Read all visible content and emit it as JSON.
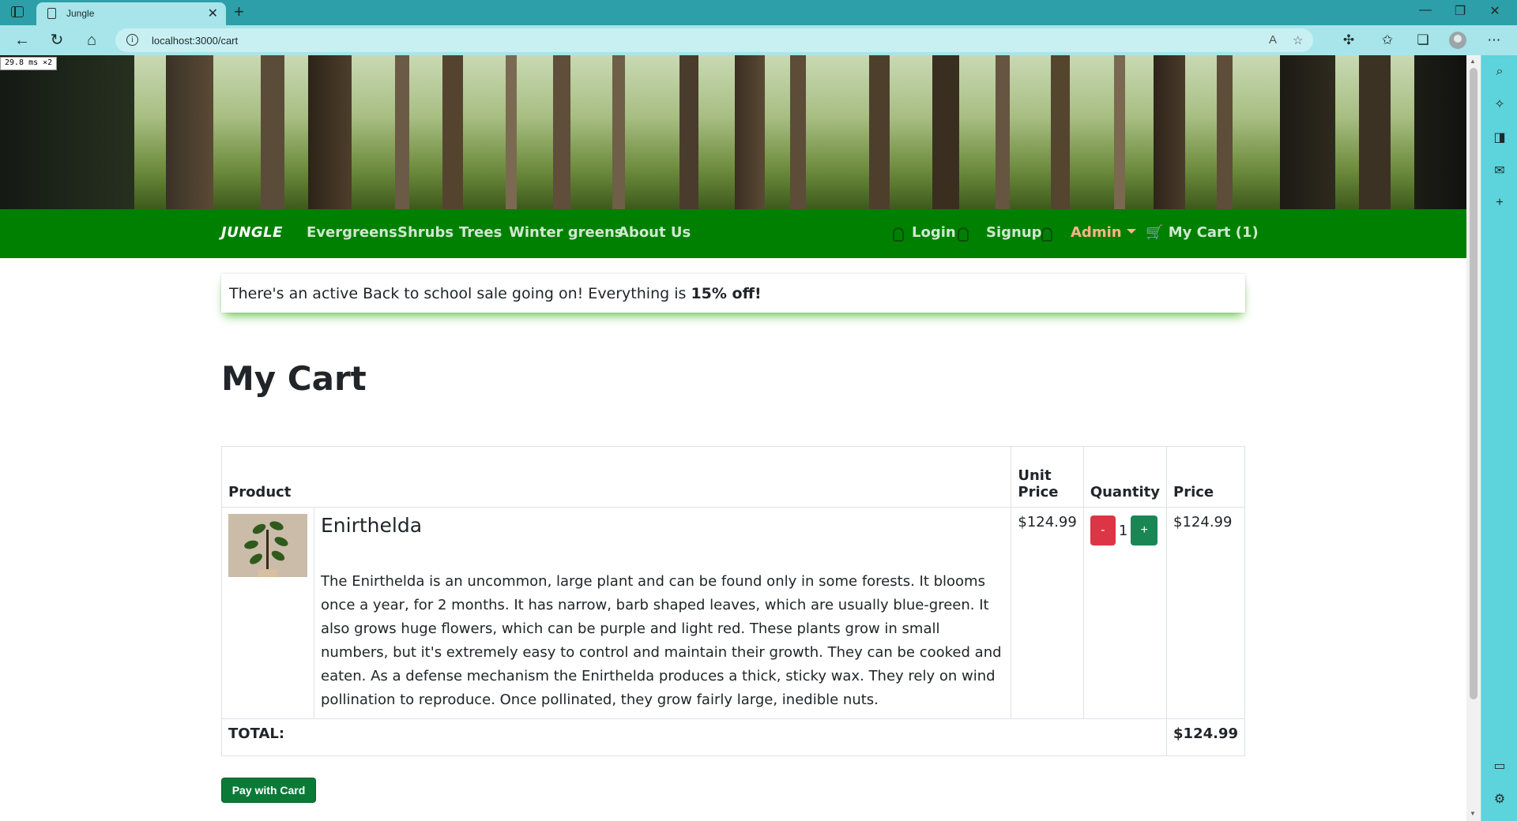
{
  "browser": {
    "tab_title": "Jungle",
    "tab_close": "✕",
    "new_tab": "+",
    "url": "localhost:3000/cart",
    "minimize": "—",
    "restore": "❐",
    "close": "✕",
    "perf_badge": "29.8 ms ×2"
  },
  "navbar": {
    "brand": "JUNGLE",
    "links": [
      "Evergreens",
      "Shrubs",
      "Trees",
      "Winter greens",
      "About Us"
    ],
    "login": "Login",
    "signup": "Signup",
    "admin": "Admin",
    "cart": "My Cart (1)"
  },
  "banner": {
    "text": "There's an active Back to school sale going on! Everything is",
    "discount": "15% off!"
  },
  "page_title": "My Cart",
  "table": {
    "headers": {
      "product": "Product",
      "unit_price_line1": "Unit",
      "unit_price_line2": "Price",
      "quantity": "Quantity",
      "price": "Price"
    },
    "rows": [
      {
        "name": "Enirthelda",
        "description": "The Enirthelda is an uncommon, large plant and can be found only in some forests. It blooms once a year, for 2 months. It has narrow, barb shaped leaves, which are usually blue-green. It also grows huge flowers, which can be purple and light red. These plants grow in small numbers, but it's extremely easy to control and maintain their growth. They can be cooked and eaten. As a defense mechanism the Enirthelda produces a thick, sticky wax. They rely on wind pollination to reproduce. Once pollinated, they grow fairly large, inedible nuts.",
        "unit_price": "$124.99",
        "minus": "-",
        "quantity": "1",
        "plus": "+",
        "price": "$124.99"
      }
    ],
    "total_label": "TOTAL:",
    "total_value": "$124.99"
  },
  "pay_button": "Pay with Card",
  "colors": {
    "navbar": "#008000",
    "minus_button": "#dc3545",
    "plus_button": "#198754",
    "pay_button": "#0a7a37",
    "admin_link": "#ffb38a"
  }
}
